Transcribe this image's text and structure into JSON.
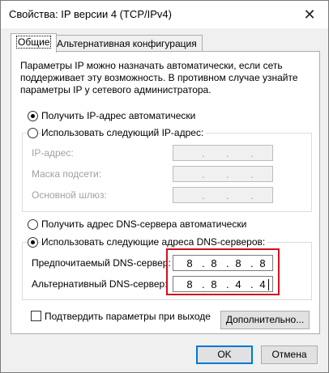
{
  "window": {
    "title": "Свойства: IP версии 4 (TCP/IPv4)",
    "close_glyph": "✕"
  },
  "tabs": [
    {
      "label": "Общие",
      "active": true
    },
    {
      "label": "Альтернативная конфигурация",
      "active": false
    }
  ],
  "description": "Параметры IP можно назначать автоматически, если сеть поддерживает эту возможность. В противном случае узнайте параметры IP у сетевого администратора.",
  "ip_mode": {
    "auto_label": "Получить IP-адрес автоматически",
    "manual_label": "Использовать следующий IP-адрес:",
    "selected": "auto"
  },
  "ip_fields": {
    "ip_label": "IP-адрес:",
    "mask_label": "Маска подсети:",
    "gateway_label": "Основной шлюз:"
  },
  "dns_mode": {
    "auto_label": "Получить адрес DNS-сервера автоматически",
    "manual_label": "Использовать следующие адреса DNS-серверов:",
    "selected": "manual"
  },
  "dns_fields": {
    "preferred_label": "Предпочитаемый DNS-сервер:",
    "preferred_octets": [
      "8",
      "8",
      "8",
      "8"
    ],
    "alternate_label": "Альтернативный DNS-сервер:",
    "alternate_octets": [
      "8",
      "8",
      "4",
      "4"
    ]
  },
  "validate": {
    "label": "Подтвердить параметры при выходе",
    "checked": false
  },
  "buttons": {
    "advanced": "Дополнительно...",
    "ok": "OK",
    "cancel": "Отмена"
  },
  "colors": {
    "highlight": "#d0101b",
    "focus": "#0078d7"
  }
}
